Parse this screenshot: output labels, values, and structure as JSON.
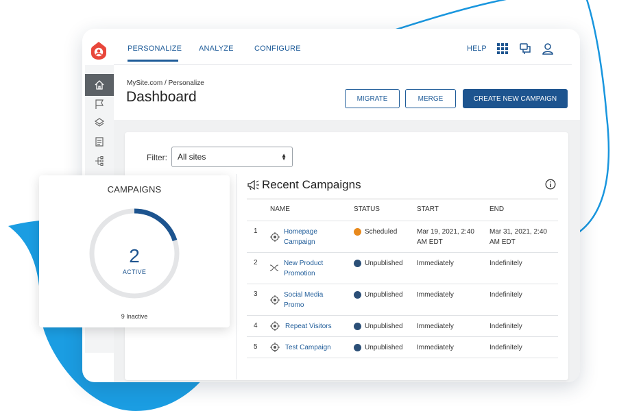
{
  "colors": {
    "brand": "#e8473b",
    "primary": "#1d548f",
    "link": "#1f5c99",
    "scheduled": "#e8891c",
    "unpublished": "#2b4f77",
    "accent_blue": "#1996de"
  },
  "nav": {
    "tabs": [
      "PERSONALIZE",
      "ANALYZE",
      "CONFIGURE"
    ],
    "active_tab": "PERSONALIZE",
    "help_label": "HELP",
    "icons": [
      "apps-grid-icon",
      "chat-icon",
      "user-icon"
    ]
  },
  "sidebar": {
    "icons": [
      "home-icon",
      "flag-icon",
      "layers-icon",
      "document-icon",
      "hierarchy-icon"
    ],
    "active": "home-icon"
  },
  "breadcrumb": "MySite.com / Personalize",
  "page_title": "Dashboard",
  "actions": {
    "migrate": "MIGRATE",
    "merge": "MERGE",
    "create": "CREATE NEW CAMPAIGN"
  },
  "filter": {
    "label": "Filter:",
    "value": "All sites"
  },
  "campaigns": {
    "title": "CAMPAIGNS",
    "active_count": "2",
    "active_label": "ACTIVE",
    "inactive_label": "9 Inactive"
  },
  "recent": {
    "title": "Recent Campaigns",
    "columns": [
      "NAME",
      "STATUS",
      "START",
      "END"
    ],
    "rows": [
      {
        "num": "1",
        "name": [
          "Homepage",
          "Campaign"
        ],
        "icon": "target-icon",
        "status": "Scheduled",
        "start": [
          "Mar 19, 2021, 2:40",
          "AM EDT"
        ],
        "end": [
          "Mar 31, 2021, 2:40",
          "AM EDT"
        ]
      },
      {
        "num": "2",
        "name": [
          "New Product",
          "Promotion"
        ],
        "icon": "split-icon",
        "status": "Unpublished",
        "start": [
          "Immediately"
        ],
        "end": [
          "Indefinitely"
        ]
      },
      {
        "num": "3",
        "name": [
          "Social Media",
          "Promo"
        ],
        "icon": "target-icon",
        "status": "Unpublished",
        "start": [
          "Immediately"
        ],
        "end": [
          "Indefinitely"
        ]
      },
      {
        "num": "4",
        "name": [
          "Repeat Visitors"
        ],
        "icon": "target-icon",
        "status": "Unpublished",
        "start": [
          "Immediately"
        ],
        "end": [
          "Indefinitely"
        ]
      },
      {
        "num": "5",
        "name": [
          "Test Campaign"
        ],
        "icon": "target-icon",
        "status": "Unpublished",
        "start": [
          "Immediately"
        ],
        "end": [
          "Indefinitely"
        ]
      }
    ]
  }
}
